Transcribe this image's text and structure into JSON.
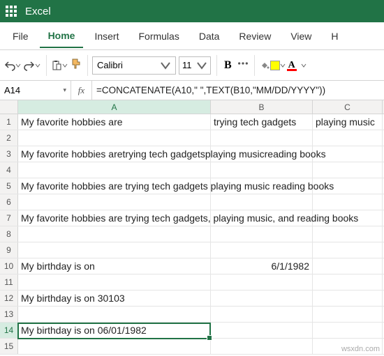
{
  "app": {
    "title": "Excel"
  },
  "menu": {
    "file": "File",
    "home": "Home",
    "insert": "Insert",
    "formulas": "Formulas",
    "data": "Data",
    "review": "Review",
    "view": "View",
    "help": "H"
  },
  "toolbar": {
    "font_name": "Calibri",
    "font_size": "11",
    "bold_label": "B"
  },
  "namebox": {
    "ref": "A14"
  },
  "fx": {
    "label": "fx",
    "formula": "=CONCATENATE(A10,\" \",TEXT(B10,\"MM/DD/YYYY\"))"
  },
  "columns": {
    "a": "A",
    "b": "B",
    "c": "C"
  },
  "rows": {
    "r1": {
      "a": "My favorite hobbies are",
      "b": "trying tech gadgets",
      "c": "playing music"
    },
    "r3": {
      "a": "My favorite hobbies aretrying tech gadgetsplaying musicreading books"
    },
    "r5": {
      "a": "My favorite hobbies are trying tech gadgets playing music reading books"
    },
    "r7": {
      "a": "My favorite hobbies are trying tech gadgets, playing music, and reading books"
    },
    "r10": {
      "a": "My birthday is on",
      "b": "6/1/1982"
    },
    "r12": {
      "a": "My birthday is on 30103"
    },
    "r14": {
      "a": "My birthday is on 06/01/1982"
    }
  },
  "row_numbers": [
    "1",
    "2",
    "3",
    "4",
    "5",
    "6",
    "7",
    "8",
    "9",
    "10",
    "11",
    "12",
    "13",
    "14",
    "15"
  ],
  "watermark": "wsxdn.com"
}
